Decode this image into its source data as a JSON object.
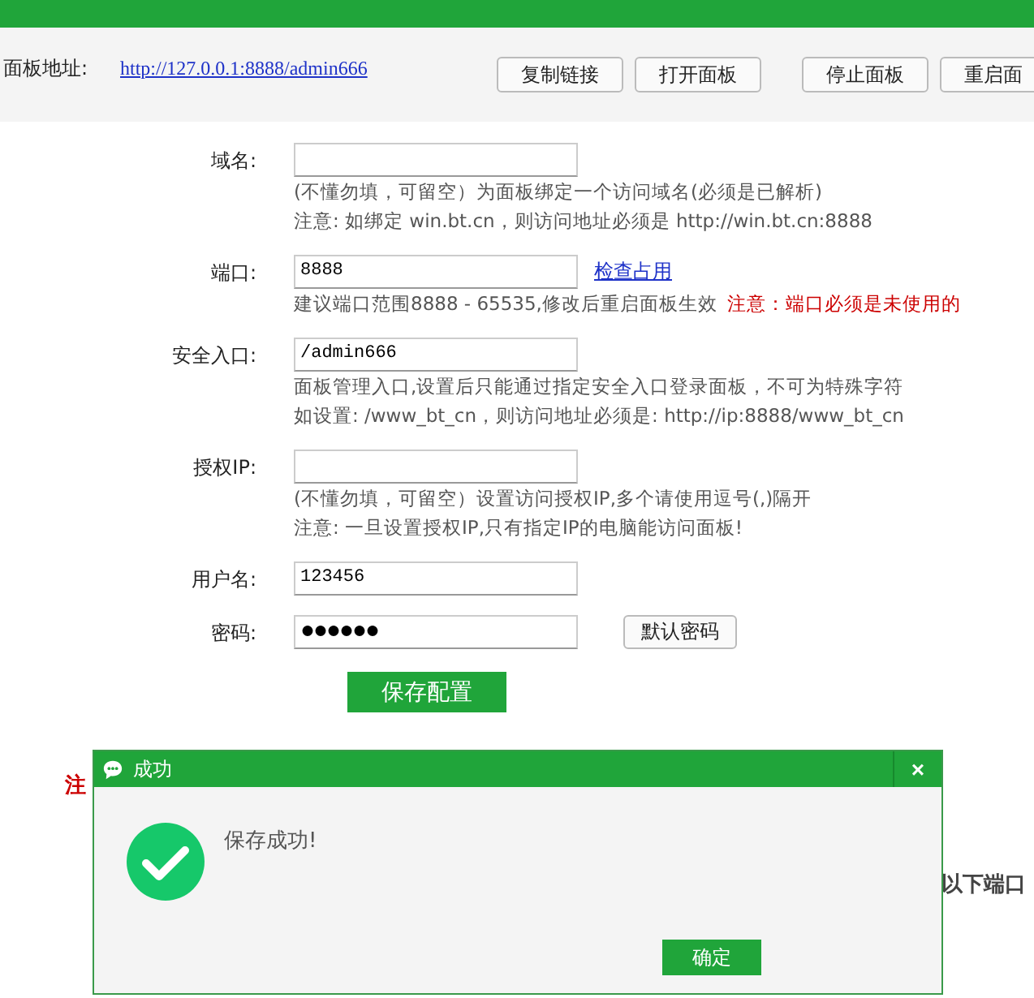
{
  "panel_address": {
    "label": "面板地址:",
    "url": "http://127.0.0.1:8888/admin666",
    "buttons": [
      "复制链接",
      "打开面板",
      "停止面板",
      "重启面"
    ]
  },
  "fields": [
    {
      "kind": "text",
      "label": "域名:",
      "hints": [
        [
          {
            "text": "(不懂勿填，可留空）为面板绑定一个访问域名(必须是已解析)",
            "kind": "note"
          }
        ],
        [
          {
            "text": "注意: 如绑定 win.bt.cn，则访问地址必须是 http://win.bt.cn:8888",
            "kind": "note"
          }
        ]
      ]
    },
    {
      "kind": "text",
      "label": "端口:",
      "value": "8888",
      "link": "检查占用",
      "hints": [
        [
          {
            "text": "建议端口范围8888 - 65535,修改后重启面板生效",
            "kind": "note"
          },
          {
            "text": "注意：端口必须是未使用的",
            "kind": "warning"
          }
        ]
      ]
    },
    {
      "kind": "text",
      "label": "安全入口:",
      "value": "/admin666",
      "hints": [
        [
          {
            "text": "面板管理入口,设置后只能通过指定安全入口登录面板，不可为特殊字符",
            "kind": "note"
          }
        ],
        [
          {
            "text": "如设置: /www_bt_cn，则访问地址必须是: http://ip:8888/www_bt_cn",
            "kind": "note"
          }
        ]
      ]
    },
    {
      "kind": "text",
      "label": "授权IP:",
      "hints": [
        [
          {
            "text": "(不懂勿填，可留空）设置访问授权IP,多个请使用逗号(,)隔开",
            "kind": "note"
          }
        ],
        [
          {
            "text": "注意: 一旦设置授权IP,只有指定IP的电脑能访问面板!",
            "kind": "note"
          }
        ]
      ]
    },
    {
      "kind": "text",
      "label": "用户名:",
      "value": "123456"
    },
    {
      "kind": "password",
      "label": "密码:",
      "value": "●●●●●●",
      "button": "默认密码"
    }
  ],
  "save_button": "保存配置",
  "background_texts": [
    {
      "text": "注",
      "kind": "warning"
    },
    {
      "text": "以下端口",
      "kind": "bold"
    }
  ],
  "dialog": {
    "title": "成功",
    "close": "×",
    "message": "保存成功!",
    "confirm": "确定"
  }
}
